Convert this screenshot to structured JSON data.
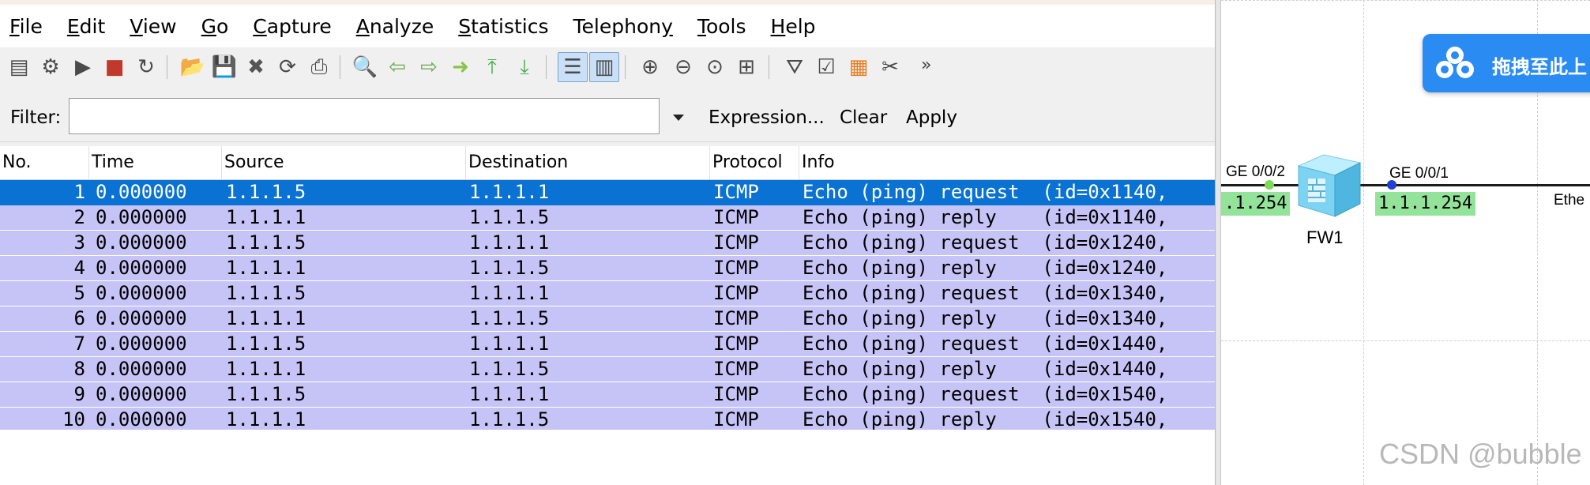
{
  "menu": [
    {
      "mnemonic": "F",
      "rest": "ile"
    },
    {
      "mnemonic": "E",
      "rest": "dit"
    },
    {
      "mnemonic": "V",
      "rest": "iew"
    },
    {
      "mnemonic": "G",
      "rest": "o"
    },
    {
      "mnemonic": "C",
      "rest": "apture"
    },
    {
      "mnemonic": "A",
      "rest": "nalyze"
    },
    {
      "mnemonic": "S",
      "rest": "tatistics"
    },
    {
      "mnemonic": "",
      "rest": "Telephon",
      "tail_mnemonic": "y"
    },
    {
      "mnemonic": "T",
      "rest": "ools"
    },
    {
      "mnemonic": "H",
      "rest": "elp"
    }
  ],
  "toolbar": {
    "icons": [
      "interface-list-icon",
      "capture-options-icon",
      "start-capture-icon",
      "stop-capture-icon",
      "restart-capture-icon",
      "open-file-icon",
      "save-file-icon",
      "close-file-icon",
      "reload-icon",
      "print-icon",
      "find-packet-icon",
      "go-back-icon",
      "go-forward-icon",
      "go-to-packet-icon",
      "go-first-icon",
      "go-last-icon",
      "colorize-icon",
      "autoscroll-icon",
      "zoom-in-icon",
      "zoom-out-icon",
      "zoom-normal-icon",
      "resize-columns-icon",
      "capture-filters-icon",
      "display-filters-icon",
      "coloring-rules-icon",
      "preferences-icon"
    ],
    "more": "»"
  },
  "filter": {
    "label": "Filter:",
    "value": "",
    "expression": "Expression...",
    "clear": "Clear",
    "apply": "Apply"
  },
  "columns": [
    "No.",
    "Time",
    "Source",
    "Destination",
    "Protocol",
    "Info"
  ],
  "packets": [
    {
      "no": "1",
      "time": "0.000000",
      "src": "1.1.1.5",
      "dst": "1.1.1.1",
      "proto": "ICMP",
      "info": "Echo (ping) request  (id=0x1140,"
    },
    {
      "no": "2",
      "time": "0.000000",
      "src": "1.1.1.1",
      "dst": "1.1.1.5",
      "proto": "ICMP",
      "info": "Echo (ping) reply    (id=0x1140,"
    },
    {
      "no": "3",
      "time": "0.000000",
      "src": "1.1.1.5",
      "dst": "1.1.1.1",
      "proto": "ICMP",
      "info": "Echo (ping) request  (id=0x1240,"
    },
    {
      "no": "4",
      "time": "0.000000",
      "src": "1.1.1.1",
      "dst": "1.1.1.5",
      "proto": "ICMP",
      "info": "Echo (ping) reply    (id=0x1240,"
    },
    {
      "no": "5",
      "time": "0.000000",
      "src": "1.1.1.5",
      "dst": "1.1.1.1",
      "proto": "ICMP",
      "info": "Echo (ping) request  (id=0x1340,"
    },
    {
      "no": "6",
      "time": "0.000000",
      "src": "1.1.1.1",
      "dst": "1.1.1.5",
      "proto": "ICMP",
      "info": "Echo (ping) reply    (id=0x1340,"
    },
    {
      "no": "7",
      "time": "0.000000",
      "src": "1.1.1.5",
      "dst": "1.1.1.1",
      "proto": "ICMP",
      "info": "Echo (ping) request  (id=0x1440,"
    },
    {
      "no": "8",
      "time": "0.000000",
      "src": "1.1.1.1",
      "dst": "1.1.1.5",
      "proto": "ICMP",
      "info": "Echo (ping) reply    (id=0x1440,"
    },
    {
      "no": "9",
      "time": "0.000000",
      "src": "1.1.1.5",
      "dst": "1.1.1.1",
      "proto": "ICMP",
      "info": "Echo (ping) request  (id=0x1540,"
    },
    {
      "no": "10",
      "time": "0.000000",
      "src": "1.1.1.1",
      "dst": "1.1.1.5",
      "proto": "ICMP",
      "info": "Echo (ping) reply    (id=0x1540,"
    }
  ],
  "selected_packet": "1",
  "colors": {
    "row_icmp": "#c6c4f7",
    "row_selected": "#0a72d2",
    "ip_badge": "#93e39a",
    "baidu_button": "#2a8cf3"
  },
  "topology": {
    "upload_button": "拖拽至此上",
    "iface_left": "GE 0/0/2",
    "iface_right": "GE 0/0/1",
    "ip_left": ".1.254",
    "ip_right": "1.1.1.254",
    "device": "FW1",
    "eth_label": "Ethe",
    "watermark": "CSDN @bubble"
  }
}
